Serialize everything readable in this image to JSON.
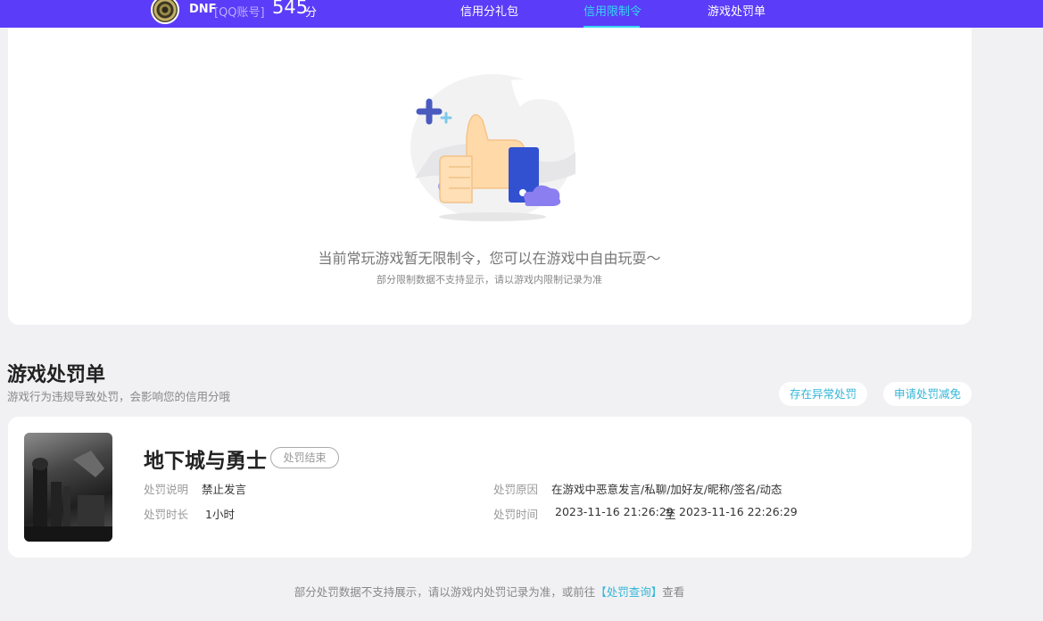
{
  "header": {
    "game": "DNF",
    "account_type": "[QQ账号]",
    "score": "545",
    "score_unit": "分",
    "nav": [
      "信用分礼包",
      "信用限制令",
      "游戏处罚单"
    ],
    "active_nav": "信用限制令",
    "accent_color": "#5b3cf8",
    "active_color": "#37d6f5"
  },
  "restriction": {
    "illustration_icon": "thumbs-up-icon",
    "message": "当前常玩游戏暂无限制令，您可以在游戏中自由玩耍～",
    "note": "部分限制数据不支持显示，请以游戏内限制记录为准"
  },
  "penalty": {
    "title": "游戏处罚单",
    "subtitle": "游戏行为违规导致处罚，会影响您的信用分哦",
    "actions": [
      "存在异常处罚",
      "申请处罚减免"
    ],
    "record": {
      "game_name": "地下城与勇士",
      "status": "处罚结束",
      "desc_label": "处罚说明",
      "desc_value": "禁止发言",
      "duration_label": "处罚时长",
      "duration_value": "1小时",
      "reason_label": "处罚原因",
      "reason_value": "在游戏中恶意发言/私聊/加好友/昵称/签名/动态",
      "time_label": "处罚时间",
      "time_start": "2023-11-16 21:26:29",
      "time_sep": "至",
      "time_end": "2023-11-16 22:26:29"
    },
    "footer_prefix": "部分处罚数据不支持展示，请以游戏内处罚记录为准，或前往",
    "footer_link": "【处罚查询】",
    "footer_suffix": "查看"
  }
}
